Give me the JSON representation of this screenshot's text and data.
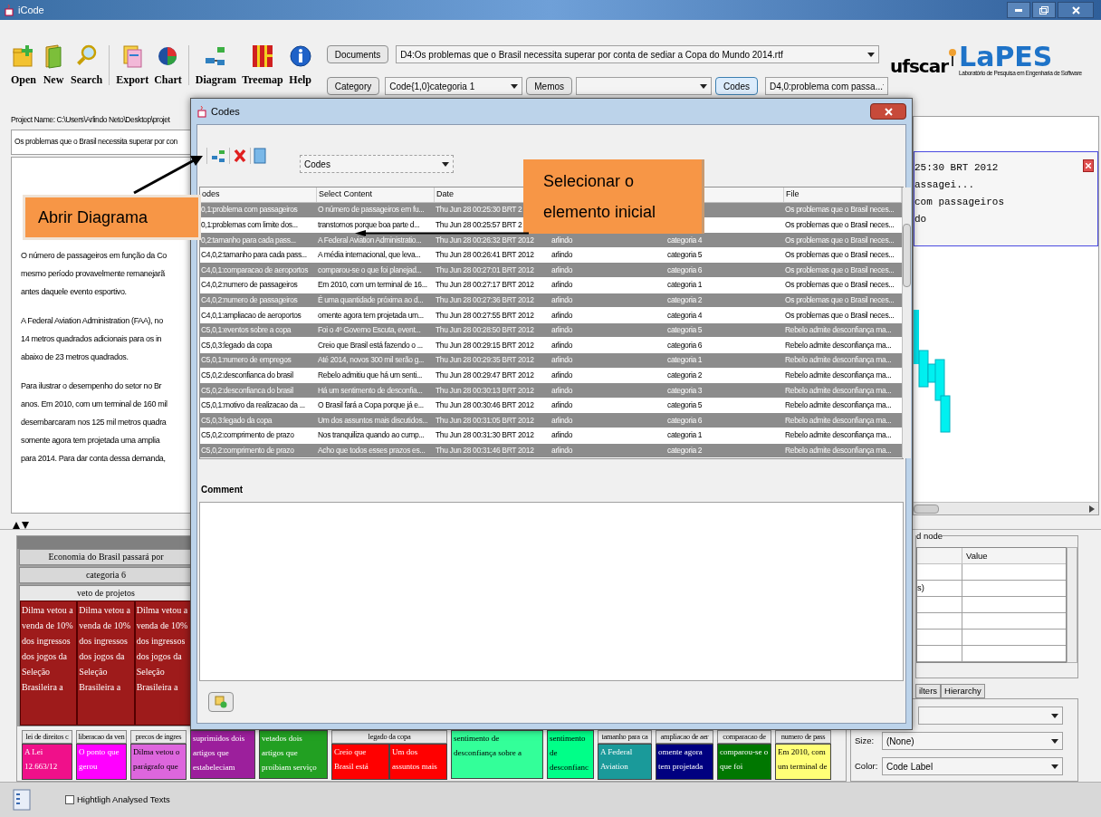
{
  "window": {
    "title": "iCode"
  },
  "toolbar": [
    {
      "label": "Open",
      "kind": "open"
    },
    {
      "label": "New",
      "kind": "new"
    },
    {
      "label": "Search",
      "kind": "search"
    },
    {
      "label": "Export",
      "kind": "export"
    },
    {
      "label": "Chart",
      "kind": "chart"
    },
    {
      "label": "Diagram",
      "kind": "diagram"
    },
    {
      "label": "Treemap",
      "kind": "treemap"
    },
    {
      "label": "Help",
      "kind": "help"
    }
  ],
  "selectors": {
    "documents_button": "Documents",
    "document": "D4:Os problemas que o Brasil necessita superar por conta de sediar a Copa do Mundo 2014.rtf",
    "category_button": "Category",
    "category": "Code{1,0}categoria 1",
    "memos_button": "Memos",
    "codes_button": "Codes",
    "code": "D4,0:problema com passa..."
  },
  "logos": {
    "ufscar": "ufscar",
    "lapes": "LaPES",
    "lapes_subtitle": "Laboratório de Pesquisa em Engenharia de Software"
  },
  "project": {
    "name_label": "Project Name: C:\\Users\\Arlindo Neto\\Desktop\\projet",
    "document_title": "Os problemas que o Brasil necessita superar por con",
    "paragraphs": [
      [
        "O número de passageiros em função da Co",
        "mesmo período provavelmente remanejarã",
        "antes daquele evento esportivo."
      ],
      [
        "A Federal Aviation Administration (FAA), no",
        "14 metros quadrados adicionais para os in",
        "abaixo de 23 metros quadrados."
      ],
      [
        "Para ilustrar o desempenho do setor no Br",
        "anos. Em 2010, com um terminal de 160 mil",
        "desembarcaram nos 125 mil metros quadra",
        "somente agora tem projetada uma amplia",
        "para 2014. Para dar conta dessa demanda,"
      ]
    ]
  },
  "memo_lines": [
    "25:30 BRT 2012",
    "assagei...",
    "com passageiros",
    "do"
  ],
  "node_group": {
    "label": "d node",
    "value_header": "Value",
    "property_text": "s)"
  },
  "tabs": [
    {
      "label": "ilters",
      "selected": false
    },
    {
      "label": "Hierarchy",
      "selected": false
    }
  ],
  "size": {
    "label": "Size:",
    "value": "(None)"
  },
  "color": {
    "label": "Color:",
    "value": "Code Label"
  },
  "treemap": {
    "title": "Economia do Brasil passará por",
    "category": "categoria 6",
    "code": "veto de projetos",
    "cells": [
      {
        "text": "Dilma vetou a venda de 10% dos ingressos dos jogos da Seleção Brasileira a",
        "color": "#9e1b1b"
      },
      {
        "text": "Dilma vetou a venda de 10% dos ingressos dos jogos da Seleção Brasileira a",
        "color": "#9e1b1b"
      },
      {
        "text": "Dilma vetou a venda de 10% dos ingressos dos jogos da Seleção Brasileira a",
        "color": "#9e1b1b"
      }
    ],
    "strip": [
      {
        "header": "lei de direitos c",
        "cells": [
          {
            "text": "A Lei 12.663/12",
            "color": "#f0108a"
          }
        ]
      },
      {
        "header": "liberacao da ven",
        "cells": [
          {
            "text": "O ponto que gerou",
            "color": "#ff00ff"
          }
        ]
      },
      {
        "header": "precos de ingres",
        "cells": [
          {
            "text": "Dilma vetou o parágrafo que",
            "color": "#dd66dd"
          }
        ]
      },
      {
        "cells": [
          {
            "text": "suprimidos dois artigos que estabeleciam",
            "color": "#9c1f9c"
          }
        ]
      },
      {
        "cells": [
          {
            "text": "vetados dois artigos que proibiam serviço",
            "color": "#22a022"
          }
        ]
      },
      {
        "header": "legado da copa",
        "cells": [
          {
            "text": "Creio que Brasil está",
            "color": "#ff0000"
          },
          {
            "text": "Um dos assuntos mais",
            "color": "#ff0000"
          }
        ]
      },
      {
        "cells": [
          {
            "text": "sentimento de desconfiança sobre a",
            "color": "#33ff99"
          }
        ]
      },
      {
        "cells": [
          {
            "text": "sentimento de desconfianc",
            "color": "#00ff88"
          }
        ]
      },
      {
        "header": "tamanho para ca",
        "cells": [
          {
            "text": "A Federal Aviation",
            "color": "#1a9a9a"
          }
        ]
      },
      {
        "header": "ampliacao de aer",
        "cells": [
          {
            "text": "omente agora tem projetada",
            "color": "#000080"
          }
        ]
      },
      {
        "header": "comparacao de",
        "cells": [
          {
            "text": "comparou-se o que foi",
            "color": "#007700"
          }
        ]
      },
      {
        "header": "numero de pass",
        "cells": [
          {
            "text": "Em 2010, com um terminal de",
            "color": "#ffff77"
          }
        ]
      }
    ]
  },
  "dialog": {
    "title": "Codes",
    "view": "Codes",
    "comment_label": "Comment",
    "columns": [
      {
        "label": "odes"
      },
      {
        "label": "Select Content"
      },
      {
        "label": "Date"
      },
      {},
      {},
      {
        "label": "File"
      }
    ],
    "rows": [
      {
        "analysed": true,
        "code": "0,1:problema com passageiros",
        "content": "O número de passageiros em fu...",
        "date": "Thu Jun 28 00:25:30 BRT 2",
        "file": "Os problemas que o Brasil neces..."
      },
      {
        "analysed": false,
        "code": "0,1:problemas com limite dos...",
        "content": "transtornos porque boa parte d...",
        "date": "Thu Jun 28 00:25:57 BRT 2",
        "file": "Os problemas que o Brasil neces..."
      },
      {
        "analysed": true,
        "code": "0,2:tamanho para cada pass...",
        "content": "A Federal Aviation Administratio...",
        "date": "Thu Jun 28 00:26:32 BRT 2012",
        "author": "arlindo",
        "category": "categoria 4",
        "file": "Os problemas que o Brasil neces..."
      },
      {
        "analysed": false,
        "code": "C4,0,2:tamanho para cada pass...",
        "content": "A média internacional, que leva...",
        "date": "Thu Jun 28 00:26:41 BRT 2012",
        "author": "arlindo",
        "category": "categoria 5",
        "file": "Os problemas que o Brasil neces..."
      },
      {
        "analysed": true,
        "code": "C4,0,1:comparacao de aeroportos",
        "content": "comparou-se o que foi planejad...",
        "date": "Thu Jun 28 00:27:01 BRT 2012",
        "author": "arlindo",
        "category": "categoria 6",
        "file": "Os problemas que o Brasil neces..."
      },
      {
        "analysed": false,
        "code": "C4,0,2:numero de passageiros",
        "content": "Em 2010, com um terminal de 16...",
        "date": "Thu Jun 28 00:27:17 BRT 2012",
        "author": "arlindo",
        "category": "categoria 1",
        "file": "Os problemas que o Brasil neces..."
      },
      {
        "analysed": true,
        "code": "C4,0,2:numero de passageiros",
        "content": "É uma quantidade próxima ao d...",
        "date": "Thu Jun 28 00:27:36 BRT 2012",
        "author": "arlindo",
        "category": "categoria 2",
        "file": "Os problemas que o Brasil neces..."
      },
      {
        "analysed": false,
        "code": "C4,0,1:ampliacao de aeroportos",
        "content": "omente agora tem projetada um...",
        "date": "Thu Jun 28 00:27:55 BRT 2012",
        "author": "arlindo",
        "category": "categoria 4",
        "file": "Os problemas que o Brasil neces..."
      },
      {
        "analysed": true,
        "code": "C5,0,1:eventos sobre a copa",
        "content": "Foi o 4º Governo Escuta, event...",
        "date": "Thu Jun 28 00:28:50 BRT 2012",
        "author": "arlindo",
        "category": "categoria 5",
        "file": "Rebelo admite desconfiança ma..."
      },
      {
        "analysed": false,
        "code": "C5,0,3:legado da copa",
        "content": "Creio que Brasil está fazendo o ...",
        "date": "Thu Jun 28 00:29:15 BRT 2012",
        "author": "arlindo",
        "category": "categoria 6",
        "file": "Rebelo admite desconfiança ma..."
      },
      {
        "analysed": true,
        "code": "C5,0,1:numero de empregos",
        "content": "Até 2014, novos 300 mil serão g...",
        "date": "Thu Jun 28 00:29:35 BRT 2012",
        "author": "arlindo",
        "category": "categoria 1",
        "file": "Rebelo admite desconfiança ma..."
      },
      {
        "analysed": false,
        "code": "C5,0,2:desconfianca do brasil",
        "content": "Rebelo admitiu que há um senti...",
        "date": "Thu Jun 28 00:29:47 BRT 2012",
        "author": "arlindo",
        "category": "categoria 2",
        "file": "Rebelo admite desconfiança ma..."
      },
      {
        "analysed": true,
        "code": "C5,0,2:desconfianca do brasil",
        "content": "Há um sentimento de desconfia...",
        "date": "Thu Jun 28 00:30:13 BRT 2012",
        "author": "arlindo",
        "category": "categoria 3",
        "file": "Rebelo admite desconfiança ma..."
      },
      {
        "analysed": false,
        "code": "C5,0,1:motivo da realizacao da ...",
        "content": "O Brasil fará a Copa porque já e...",
        "date": "Thu Jun 28 00:30:46 BRT 2012",
        "author": "arlindo",
        "category": "categoria 5",
        "file": "Rebelo admite desconfiança ma..."
      },
      {
        "analysed": true,
        "code": "C5,0,3:legado da copa",
        "content": "Um dos assuntos mais discutidos...",
        "date": "Thu Jun 28 00:31:05 BRT 2012",
        "author": "arlindo",
        "category": "categoria 6",
        "file": "Rebelo admite desconfiança ma..."
      },
      {
        "analysed": false,
        "code": "C5,0,2:comprimento de prazo",
        "content": "Nos tranquiliza quando ao cump...",
        "date": "Thu Jun 28 00:31:30 BRT 2012",
        "author": "arlindo",
        "category": "categoria 1",
        "file": "Rebelo admite desconfiança ma..."
      },
      {
        "analysed": true,
        "code": "C5,0,2:comprimento de prazo",
        "content": "Acho que todos esses prazos es...",
        "date": "Thu Jun 28 00:31:46 BRT 2012",
        "author": "arlindo",
        "category": "categoria 2",
        "file": "Rebelo admite desconfiança ma..."
      }
    ]
  },
  "callouts": [
    {
      "lines": [
        "Abrir Diagrama"
      ]
    },
    {
      "lines": [
        "Selecionar o",
        "elemento inicial"
      ]
    }
  ],
  "status_bar": {
    "highlight": {
      "label": "Hightligh Analysed Texts",
      "checked": false
    }
  }
}
